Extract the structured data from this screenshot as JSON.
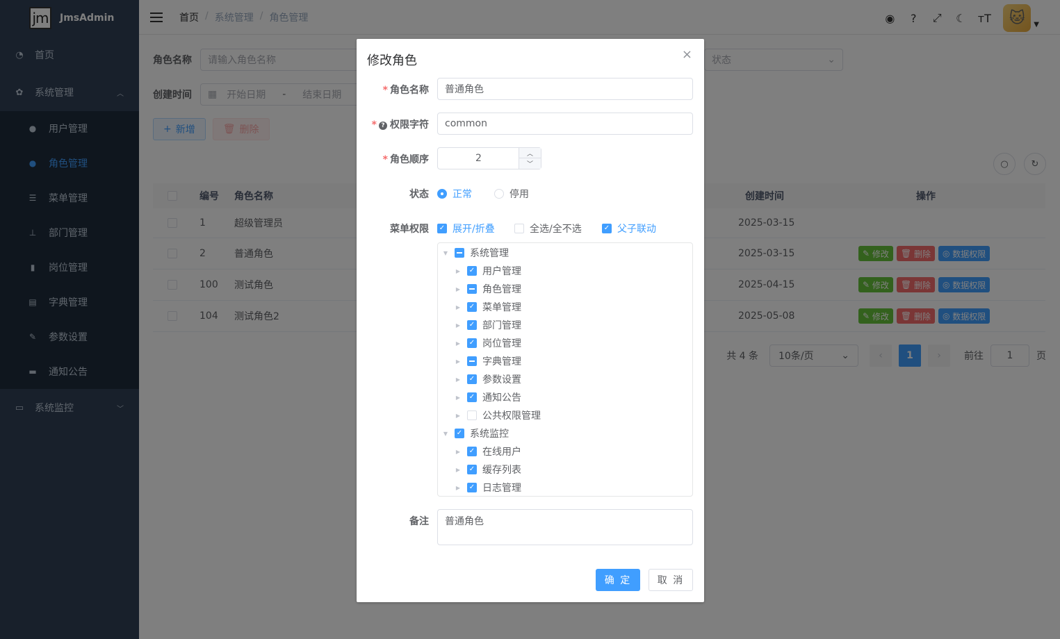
{
  "app": {
    "logo_mark": "jm",
    "name": "JmsAdmin"
  },
  "sidebar": {
    "items": [
      {
        "label": "首页",
        "icon": "dashboard-icon"
      },
      {
        "label": "系统管理",
        "icon": "gear-icon",
        "expanded": true
      },
      {
        "label": "系统监控",
        "icon": "monitor-icon",
        "expanded": false
      }
    ],
    "sub_items": [
      {
        "label": "用户管理",
        "icon": "user-icon"
      },
      {
        "label": "角色管理",
        "icon": "role-icon",
        "active": true
      },
      {
        "label": "菜单管理",
        "icon": "menu-icon"
      },
      {
        "label": "部门管理",
        "icon": "tree-icon"
      },
      {
        "label": "岗位管理",
        "icon": "post-icon"
      },
      {
        "label": "字典管理",
        "icon": "dict-icon"
      },
      {
        "label": "参数设置",
        "icon": "edit-icon"
      },
      {
        "label": "通知公告",
        "icon": "message-icon"
      }
    ]
  },
  "breadcrumb": [
    "首页",
    "系统管理",
    "角色管理"
  ],
  "search": {
    "role_name_label": "角色名称",
    "role_name_placeholder": "请输入角色名称",
    "status_placeholder": "状态",
    "created_label": "创建时间",
    "start_placeholder": "开始日期",
    "range_sep": "-",
    "end_placeholder": "结束日期"
  },
  "toolbar": {
    "add_label": "新增",
    "delete_label": "删除"
  },
  "table": {
    "headers": {
      "id": "编号",
      "name": "角色名称",
      "created": "创建时间",
      "ops": "操作"
    },
    "rows": [
      {
        "id": "1",
        "name": "超级管理员",
        "created": "2025-03-15",
        "ops": false
      },
      {
        "id": "2",
        "name": "普通角色",
        "created": "2025-03-15",
        "ops": true
      },
      {
        "id": "100",
        "name": "测试角色",
        "created": "2025-04-15",
        "ops": true
      },
      {
        "id": "104",
        "name": "测试角色2",
        "created": "2025-05-08",
        "ops": true
      }
    ],
    "op_labels": {
      "edit": "修改",
      "delete": "删除",
      "data_scope": "数据权限"
    }
  },
  "pagination": {
    "total": "共 4 条",
    "page_size": "10条/页",
    "current": "1",
    "goto_label": "前往",
    "goto_value": "1",
    "page_suffix": "页"
  },
  "dialog": {
    "title": "修改角色",
    "close": "×",
    "fields": {
      "role_name_label": "角色名称",
      "role_name_value": "普通角色",
      "role_key_label": "权限字符",
      "role_key_value": "common",
      "role_sort_label": "角色顺序",
      "role_sort_value": "2",
      "status_label": "状态",
      "status_normal": "正常",
      "status_disabled": "停用",
      "menu_label": "菜单权限",
      "expand_label": "展开/折叠",
      "select_all_label": "全选/全不选",
      "linkage_label": "父子联动",
      "remark_label": "备注",
      "remark_value": "普通角色"
    },
    "tree": [
      {
        "label": "系统管理",
        "level": 0,
        "state": "half",
        "expanded": true
      },
      {
        "label": "用户管理",
        "level": 1,
        "state": "on"
      },
      {
        "label": "角色管理",
        "level": 1,
        "state": "half"
      },
      {
        "label": "菜单管理",
        "level": 1,
        "state": "on"
      },
      {
        "label": "部门管理",
        "level": 1,
        "state": "on"
      },
      {
        "label": "岗位管理",
        "level": 1,
        "state": "on"
      },
      {
        "label": "字典管理",
        "level": 1,
        "state": "half"
      },
      {
        "label": "参数设置",
        "level": 1,
        "state": "on"
      },
      {
        "label": "通知公告",
        "level": 1,
        "state": "on"
      },
      {
        "label": "公共权限管理",
        "level": 1,
        "state": "off"
      },
      {
        "label": "系统监控",
        "level": 0,
        "state": "on",
        "expanded": true
      },
      {
        "label": "在线用户",
        "level": 1,
        "state": "on"
      },
      {
        "label": "缓存列表",
        "level": 1,
        "state": "on"
      },
      {
        "label": "日志管理",
        "level": 1,
        "state": "on"
      }
    ],
    "confirm": "确 定",
    "cancel": "取 消"
  },
  "colors": {
    "primary": "#409eff",
    "success": "#67c23a",
    "danger": "#f56c6c",
    "sidebar": "#304156"
  }
}
